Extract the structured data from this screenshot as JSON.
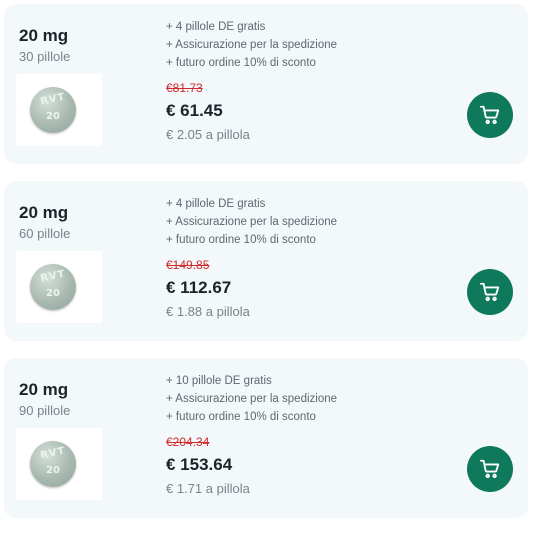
{
  "offers": [
    {
      "dose": "20 mg",
      "count": "30 pillole",
      "pill_marking": [
        "RVT",
        "20"
      ],
      "perks": [
        "+ 4 pillole DE gratis",
        "+ Assicurazione per la spedizione",
        "+ futuro ordine 10% di sconto"
      ],
      "old_price": "€81.73",
      "price": "€ 61.45",
      "per_pill": "€ 2.05 a pillola",
      "cart_icon": "cart-icon"
    },
    {
      "dose": "20 mg",
      "count": "60 pillole",
      "pill_marking": [
        "RVT",
        "20"
      ],
      "perks": [
        "+ 4 pillole DE gratis",
        "+ Assicurazione per la spedizione",
        "+ futuro ordine 10% di sconto"
      ],
      "old_price": "€149.85",
      "price": "€ 112.67",
      "per_pill": "€ 1.88 a pillola",
      "cart_icon": "cart-icon"
    },
    {
      "dose": "20 mg",
      "count": "90 pillole",
      "pill_marking": [
        "RVT",
        "20"
      ],
      "perks": [
        "+ 10 pillole DE gratis",
        "+ Assicurazione per la spedizione",
        "+ futuro ordine 10% di sconto"
      ],
      "old_price": "€204.34",
      "price": "€ 153.64",
      "per_pill": "€ 1.71 a pillola",
      "cart_icon": "cart-icon"
    }
  ],
  "colors": {
    "card_background": "#f3f8fb",
    "cart_button": "#0f7a5b",
    "old_price": "#d22a2a",
    "text_dark": "#1d2328",
    "text_muted": "#7a838a"
  }
}
